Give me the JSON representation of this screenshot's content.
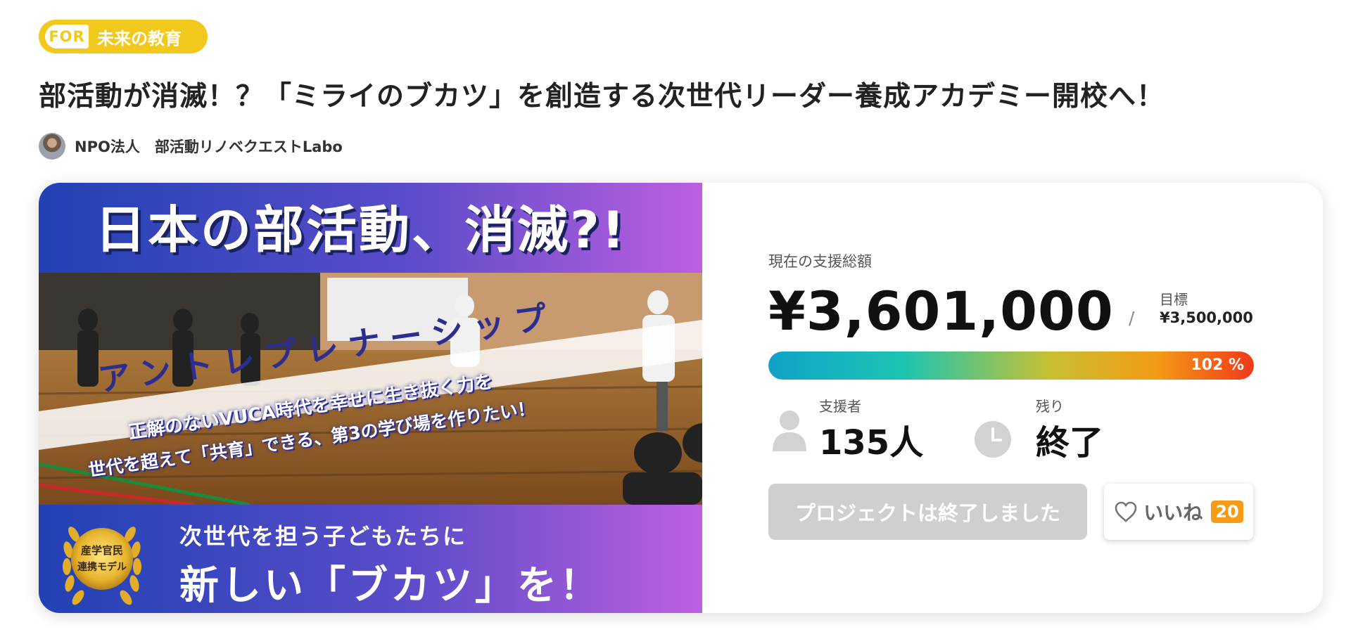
{
  "category": {
    "prefix": "FOR",
    "label": "未来の教育"
  },
  "project": {
    "title": "部活動が消滅！？「ミライのブカツ」を創造する次世代リーダー養成アカデミー開校へ！",
    "owner": "NPO法人　部活動リノベクエストLabo"
  },
  "hero": {
    "headline": "日本の部活動、消滅?!",
    "banner": "アントレプレナーシップ",
    "line1": "正解のないVUCA時代を幸せに生き抜く力を",
    "line2": "世代を超えて「共育」できる、第3の学び場を作りたい！",
    "seal_line1": "産学官民",
    "seal_line2": "連携モデル",
    "bottom_line1": "次世代を担う子どもたちに",
    "bottom_line2": "新しい「ブカツ」を！"
  },
  "stats": {
    "current_label": "現在の支援総額",
    "amount": "¥3,601,000",
    "separator": "/",
    "goal_label": "目標",
    "goal_value": "¥3,500,000",
    "progress_percent": 102,
    "progress_text": "102 %",
    "supporters_label": "支援者",
    "supporters_value": "135人",
    "remaining_label": "残り",
    "remaining_value": "終了"
  },
  "actions": {
    "ended_button": "プロジェクトは終了しました",
    "like_label": "いいね",
    "like_count": "20"
  },
  "colors": {
    "badge": "#f3c81c",
    "like_count": "#f79a14",
    "progress_start": "#10a2c9",
    "progress_end": "#f0391a",
    "hero_left": "#2142b4",
    "hero_right": "#bc5fe0"
  },
  "icons": {
    "supporters": "person-icon",
    "remaining": "clock-icon",
    "like": "heart-icon",
    "seal": "laurel-seal-icon"
  }
}
